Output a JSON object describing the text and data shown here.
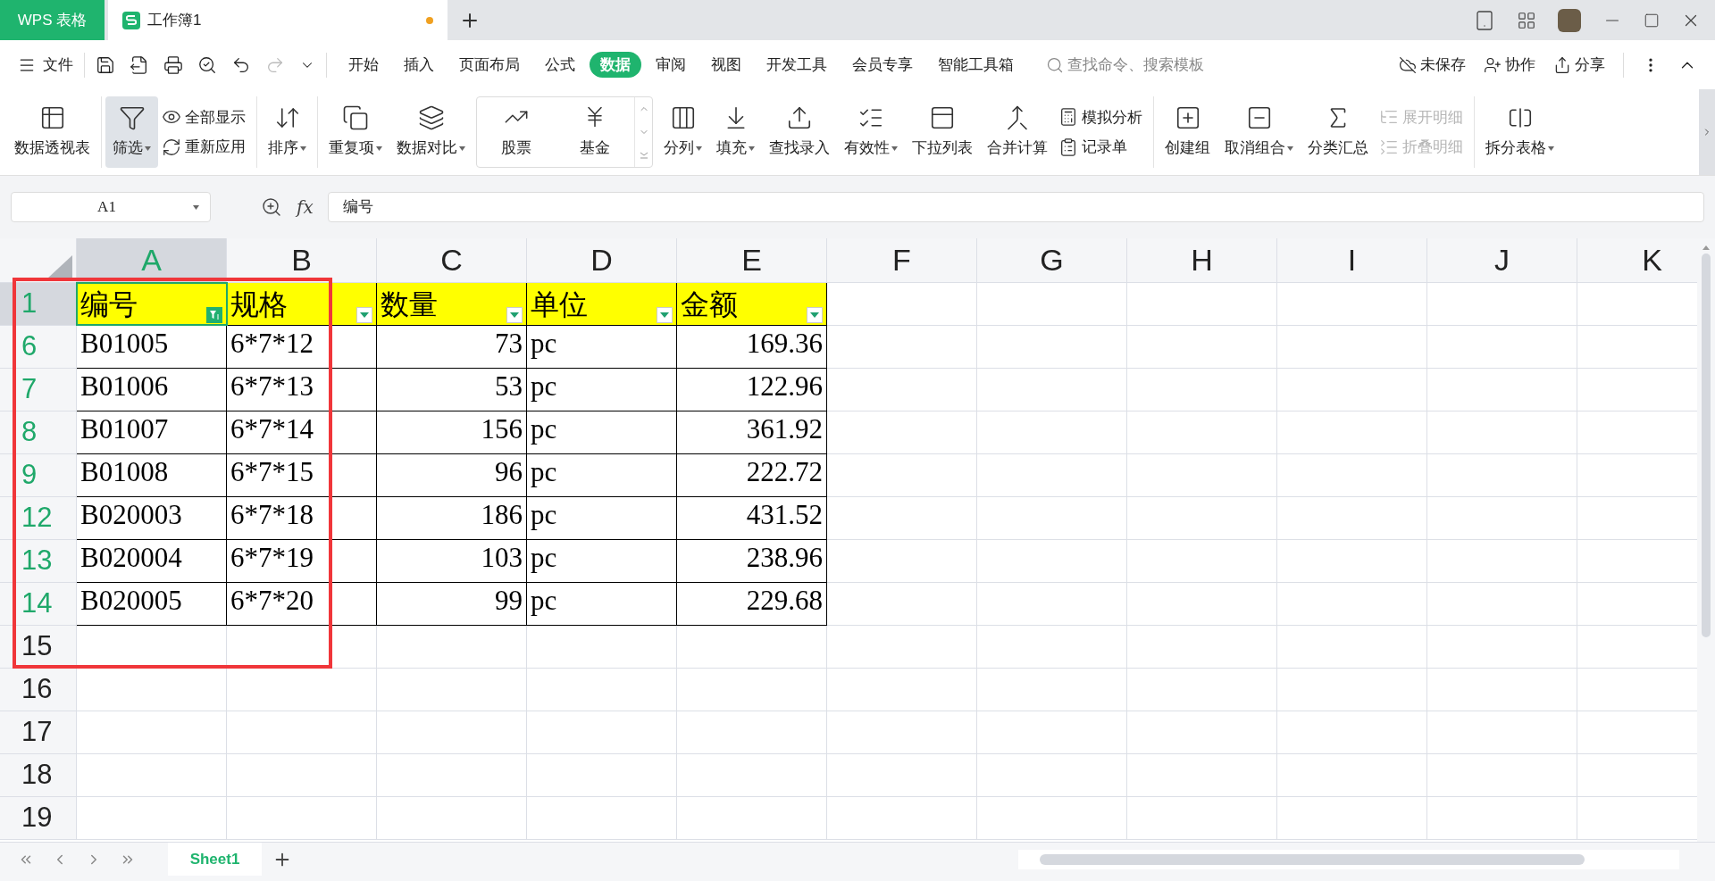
{
  "app_tab": "WPS 表格",
  "doc_tab": {
    "title": "工作簿1",
    "unsaved": true
  },
  "file_menu": "文件",
  "menu_tabs": [
    {
      "label": "开始",
      "selected": false
    },
    {
      "label": "插入",
      "selected": false
    },
    {
      "label": "页面布局",
      "selected": false
    },
    {
      "label": "公式",
      "selected": false
    },
    {
      "label": "数据",
      "selected": true
    },
    {
      "label": "审阅",
      "selected": false
    },
    {
      "label": "视图",
      "selected": false
    },
    {
      "label": "开发工具",
      "selected": false
    },
    {
      "label": "会员专享",
      "selected": false
    },
    {
      "label": "智能工具箱",
      "selected": false
    }
  ],
  "search": {
    "placeholder": "查找命令、搜索模板"
  },
  "right_actions": [
    "未保存",
    "协作",
    "分享"
  ],
  "ribbon": [
    {
      "kind": "large",
      "label": "数据透视表",
      "dropdown": false,
      "pressed": false,
      "sep_after": true
    },
    {
      "kind": "large",
      "label": "筛选",
      "dropdown": true,
      "pressed": true,
      "sep_after": false
    },
    {
      "kind": "stack",
      "items": [
        {
          "label": "全部显示",
          "disabled": false
        },
        {
          "label": "重新应用",
          "disabled": false
        }
      ],
      "sep_after": true
    },
    {
      "kind": "large",
      "label": "排序",
      "dropdown": true,
      "pressed": false,
      "sep_after": true
    },
    {
      "kind": "large",
      "label": "重复项",
      "dropdown": true,
      "pressed": false,
      "sep_after": false
    },
    {
      "kind": "large",
      "label": "数据对比",
      "dropdown": true,
      "pressed": false,
      "sep_after": false
    },
    {
      "kind": "gallery",
      "items": [
        "股票",
        "基金"
      ]
    },
    {
      "kind": "large",
      "label": "分列",
      "dropdown": true,
      "pressed": false,
      "sep_after": false
    },
    {
      "kind": "large",
      "label": "填充",
      "dropdown": true,
      "pressed": false,
      "sep_after": false
    },
    {
      "kind": "large",
      "label": "查找录入",
      "dropdown": false,
      "pressed": false,
      "sep_after": false
    },
    {
      "kind": "large",
      "label": "有效性",
      "dropdown": true,
      "pressed": false,
      "sep_after": false
    },
    {
      "kind": "large",
      "label": "下拉列表",
      "dropdown": false,
      "pressed": false,
      "sep_after": false
    },
    {
      "kind": "large",
      "label": "合并计算",
      "dropdown": false,
      "pressed": false,
      "sep_after": false
    },
    {
      "kind": "stack",
      "items": [
        {
          "label": "模拟分析",
          "disabled": false
        },
        {
          "label": "记录单",
          "disabled": false
        }
      ],
      "sep_after": true
    },
    {
      "kind": "large",
      "label": "创建组",
      "dropdown": false,
      "pressed": false,
      "sep_after": false
    },
    {
      "kind": "large",
      "label": "取消组合",
      "dropdown": true,
      "pressed": false,
      "sep_after": false
    },
    {
      "kind": "large",
      "label": "分类汇总",
      "dropdown": false,
      "pressed": false,
      "sep_after": false
    },
    {
      "kind": "stack",
      "items": [
        {
          "label": "展开明细",
          "disabled": true
        },
        {
          "label": "折叠明细",
          "disabled": true
        }
      ],
      "sep_after": true
    },
    {
      "kind": "large",
      "label": "拆分表格",
      "dropdown": true,
      "pressed": false,
      "sep_after": false
    }
  ],
  "name_box": "A1",
  "fx": "fx",
  "formula": "编号",
  "columns": [
    {
      "label": "A",
      "selected": true
    },
    {
      "label": "B",
      "selected": false
    },
    {
      "label": "C",
      "selected": false
    },
    {
      "label": "D",
      "selected": false
    },
    {
      "label": "E",
      "selected": false
    },
    {
      "label": "F",
      "selected": false
    },
    {
      "label": "G",
      "selected": false
    },
    {
      "label": "H",
      "selected": false
    },
    {
      "label": "I",
      "selected": false
    },
    {
      "label": "J",
      "selected": false
    },
    {
      "label": "K",
      "selected": false
    }
  ],
  "rows": [
    {
      "number": "1",
      "kind": "header",
      "filtered": true,
      "selected": true,
      "cells": [
        {
          "text": "编号",
          "filter_active": true
        },
        {
          "text": "规格",
          "filter_active": false
        },
        {
          "text": "数量",
          "filter_active": false
        },
        {
          "text": "单位",
          "filter_active": false
        },
        {
          "text": "金额",
          "filter_active": false
        }
      ]
    },
    {
      "number": "6",
      "kind": "data",
      "filtered": true,
      "selected": false,
      "cells": [
        "B01005",
        "6*7*12",
        "73",
        "pc",
        "169.36"
      ]
    },
    {
      "number": "7",
      "kind": "data",
      "filtered": true,
      "selected": false,
      "cells": [
        "B01006",
        "6*7*13",
        "53",
        "pc",
        "122.96"
      ]
    },
    {
      "number": "8",
      "kind": "data",
      "filtered": true,
      "selected": false,
      "cells": [
        "B01007",
        "6*7*14",
        "156",
        "pc",
        "361.92"
      ]
    },
    {
      "number": "9",
      "kind": "data",
      "filtered": true,
      "selected": false,
      "cells": [
        "B01008",
        "6*7*15",
        "96",
        "pc",
        "222.72"
      ]
    },
    {
      "number": "12",
      "kind": "data",
      "filtered": true,
      "selected": false,
      "cells": [
        "B020003",
        "6*7*18",
        "186",
        "pc",
        "431.52"
      ]
    },
    {
      "number": "13",
      "kind": "data",
      "filtered": true,
      "selected": false,
      "cells": [
        "B020004",
        "6*7*19",
        "103",
        "pc",
        "238.96"
      ]
    },
    {
      "number": "14",
      "kind": "data",
      "filtered": true,
      "selected": false,
      "cells": [
        "B020005",
        "6*7*20",
        "99",
        "pc",
        "229.68"
      ]
    },
    {
      "number": "15",
      "kind": "empty",
      "filtered": false,
      "selected": false,
      "cells": []
    },
    {
      "number": "16",
      "kind": "empty",
      "filtered": false,
      "selected": false,
      "cells": []
    },
    {
      "number": "17",
      "kind": "empty",
      "filtered": false,
      "selected": false,
      "cells": []
    },
    {
      "number": "18",
      "kind": "empty",
      "filtered": false,
      "selected": false,
      "cells": []
    },
    {
      "number": "19",
      "kind": "empty",
      "filtered": false,
      "selected": false,
      "cells": []
    }
  ],
  "sheets": [
    {
      "label": "Sheet1",
      "selected": true
    }
  ]
}
